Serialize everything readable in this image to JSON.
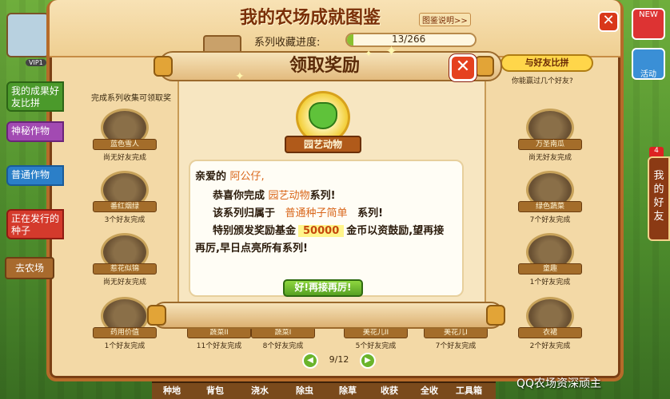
{
  "panel": {
    "title": "我的农场成就图鉴",
    "guide_link": "图鉴说明>>",
    "progress_label": "系列收藏进度:",
    "progress_text": "13/266",
    "progress_value": 0.049,
    "collect_hint": "完成系列收集可领取奖",
    "vip": "VIP1"
  },
  "sidebar": {
    "tabs": [
      {
        "label": "我的成果好友比拼"
      },
      {
        "label": "神秘作物"
      },
      {
        "label": "普通作物"
      },
      {
        "label": "正在发行的种子"
      }
    ],
    "farm_sign": "去农场"
  },
  "right": {
    "compare_button": "与好友比拼",
    "beat_text": "你能赢过几个好友?",
    "news_label": "NEW",
    "activity_label": "活动",
    "friends_label": "我的好友",
    "friends_count": "4"
  },
  "badges": [
    {
      "name": "蓝色雪人",
      "status": "尚无好友完成"
    },
    {
      "name": "万圣南瓜",
      "status": "尚无好友完成"
    },
    {
      "name": "番红烟绿",
      "status": "3个好友完成"
    },
    {
      "name": "绿色蔬菜",
      "status": "7个好友完成"
    },
    {
      "name": "惹花似锦",
      "status": "尚无好友完成"
    },
    {
      "name": "童趣",
      "status": "1个好友完成"
    },
    {
      "name": "药用价值",
      "status": "1个好友完成"
    },
    {
      "name": "蔬菜II",
      "status": "11个好友完成"
    },
    {
      "name": "蔬菜I",
      "status": "8个好友完成"
    },
    {
      "name": "美花儿II",
      "status": "5个好友完成"
    },
    {
      "name": "美花儿I",
      "status": "7个好友完成"
    },
    {
      "name": "衣裙",
      "status": "2个好友完成"
    }
  ],
  "pager": {
    "page": "9/12",
    "prev": "◀",
    "next": "▶"
  },
  "toolbar": [
    "种地",
    "背包",
    "浇水",
    "除虫",
    "除草",
    "收获",
    "全收",
    "工具箱"
  ],
  "watermark": "QQ农场资深顽主",
  "dialog": {
    "title": "领取奖励",
    "close": "✕",
    "award_name": "园艺动物",
    "greeting": "亲爱的",
    "user_name": "阿公仔,",
    "line1_prefix": "恭喜你完成",
    "series_name": "园艺动物",
    "line1_suffix": "系列!",
    "line2_prefix": "该系列归属于",
    "category": "普通种子简单",
    "line2_suffix": "系列!",
    "line3_prefix": "特别颁发奖励基金",
    "coin_amount": "50000",
    "line3_suffix": "金币以资鼓励,望再接",
    "line4": "再厉,早日点亮所有系列!",
    "ok_button": "好!再接再厉!"
  }
}
